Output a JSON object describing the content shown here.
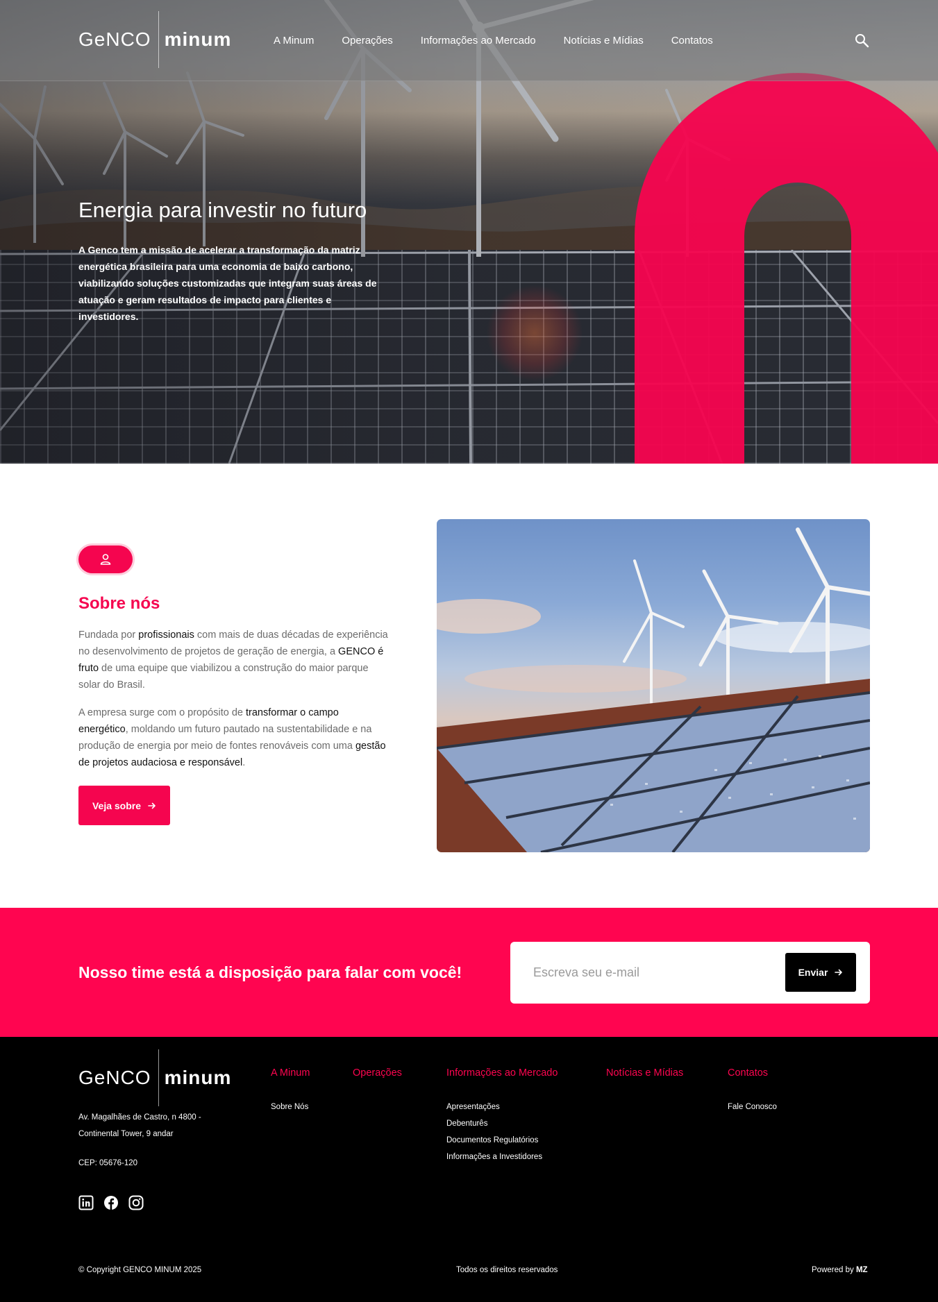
{
  "header": {
    "logo_left": "GeNCO",
    "logo_right": "minum",
    "nav": [
      "A Minum",
      "Operações",
      "Informações ao Mercado",
      "Notícias e Mídias",
      "Contatos"
    ]
  },
  "hero": {
    "title": "Energia para investir no futuro",
    "description": "A Genco tem a missão de acelerar a transformação da matriz energética brasileira para uma economia de baixo carbono, viabilizando soluções customizadas que integram suas áreas de atuação e geram resultados de impacto para clientes e investidores."
  },
  "about": {
    "title": "Sobre nós",
    "p1": {
      "a": "Fundada por ",
      "b": "profissionais",
      "c": " com mais de duas décadas de experiência no desenvolvimento de projetos de geração de energia, a ",
      "d": "GENCO é fruto",
      "e": " de uma equipe que viabilizou a construção do maior parque solar do Brasil."
    },
    "p2": {
      "a": "A empresa surge com o propósito de ",
      "b": "transformar o campo energético",
      "c": ", moldando um futuro pautado na sustentabilidade e na produção de energia por meio de fontes renováveis com uma ",
      "d": "gestão de projetos audaciosa e responsável",
      "e": "."
    },
    "button": "Veja sobre"
  },
  "cta": {
    "text": "Nosso time está a disposição para falar com você!",
    "placeholder": "Escreva seu e-mail",
    "button": "Enviar"
  },
  "footer": {
    "address_line1": "Av. Magalhães de Castro, n 4800 -",
    "address_line2": "Continental Tower, 9 andar",
    "cep": "CEP: 05676-120",
    "columns": [
      {
        "title": "A Minum",
        "items": [
          "Sobre Nós"
        ]
      },
      {
        "title": "Operações",
        "items": []
      },
      {
        "title": "Informações ao Mercado",
        "items": [
          "Apresentações",
          "Debenturês",
          "Documentos Regulatórios",
          "Informações a Investidores"
        ]
      },
      {
        "title": "Notícias e Mídias",
        "items": []
      },
      {
        "title": "Contatos",
        "items": [
          "Fale Conosco"
        ]
      }
    ],
    "copyright": "© Copyright GENCO MINUM 2025",
    "rights": "Todos os direitos reservados",
    "powered_by": "Powered by",
    "powered_brand": "MZ"
  },
  "colors": {
    "accent": "#ff0550",
    "footer_bg": "#000000"
  },
  "icons": [
    "search-icon",
    "user-icon",
    "arrow-right-icon",
    "linkedin-icon",
    "facebook-icon",
    "instagram-icon"
  ]
}
